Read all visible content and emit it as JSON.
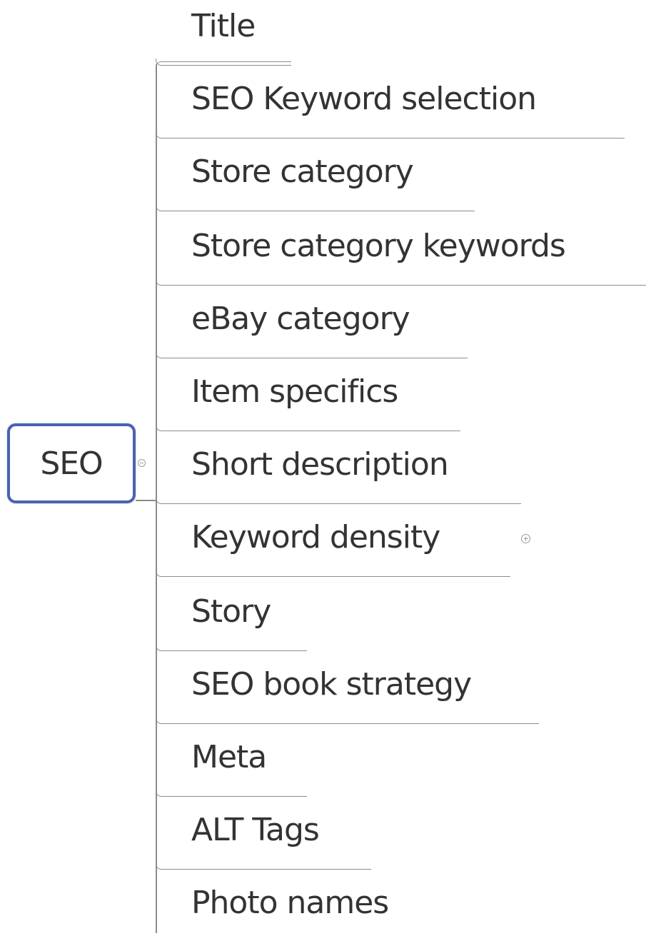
{
  "mindmap": {
    "root": {
      "label": "SEO",
      "toggle_icon": "collapse-icon",
      "border_color": "#4a63ad"
    },
    "children": [
      {
        "label": "Title",
        "has_collapsed_children": false
      },
      {
        "label": "SEO Keyword selection",
        "has_collapsed_children": false
      },
      {
        "label": "Store category",
        "has_collapsed_children": false
      },
      {
        "label": "Store category keywords",
        "has_collapsed_children": false
      },
      {
        "label": "eBay category",
        "has_collapsed_children": false
      },
      {
        "label": "Item specifics",
        "has_collapsed_children": false
      },
      {
        "label": "Short description",
        "has_collapsed_children": false
      },
      {
        "label": "Keyword density",
        "has_collapsed_children": true
      },
      {
        "label": "Story",
        "has_collapsed_children": false
      },
      {
        "label": "SEO book strategy",
        "has_collapsed_children": false
      },
      {
        "label": "Meta",
        "has_collapsed_children": false
      },
      {
        "label": "ALT Tags",
        "has_collapsed_children": false
      },
      {
        "label": "Photo names",
        "has_collapsed_children": false
      }
    ],
    "colors": {
      "text": "#333333",
      "connector": "#8c8c8c",
      "root_border": "#4a63ad"
    }
  }
}
